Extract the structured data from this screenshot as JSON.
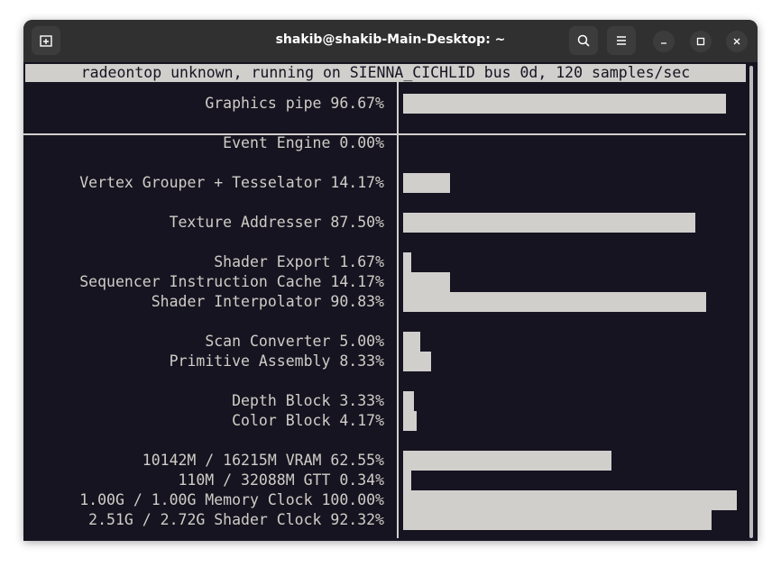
{
  "window": {
    "title": "shakib@shakib-Main-Desktop: ~",
    "icons": [
      "new-tab-icon",
      "search-icon",
      "menu-icon",
      "minimize-icon",
      "maximize-icon",
      "close-icon"
    ]
  },
  "terminal": {
    "header": "radeontop unknown, running on SIENNA_CICHLID bus 0d, 120 samples/sec",
    "rows": [
      {
        "label": "Graphics pipe",
        "value": "96.67%",
        "percent": 96.67
      },
      {
        "label": "Event Engine",
        "value": "0.00%",
        "percent": 0.0
      },
      {
        "label": "Vertex Grouper + Tesselator",
        "value": "14.17%",
        "percent": 14.17
      },
      {
        "label": "Texture Addresser",
        "value": "87.50%",
        "percent": 87.5
      },
      {
        "label": "Shader Export",
        "value": "1.67%",
        "percent": 1.67
      },
      {
        "label": "Sequencer Instruction Cache",
        "value": "14.17%",
        "percent": 14.17
      },
      {
        "label": "Shader Interpolator",
        "value": "90.83%",
        "percent": 90.83
      },
      {
        "label": "Scan Converter",
        "value": "5.00%",
        "percent": 5.0
      },
      {
        "label": "Primitive Assembly",
        "value": "8.33%",
        "percent": 8.33
      },
      {
        "label": "Depth Block",
        "value": "3.33%",
        "percent": 3.33
      },
      {
        "label": "Color Block",
        "value": "4.17%",
        "percent": 4.17
      },
      {
        "label": "10142M / 16215M VRAM",
        "value": "62.55%",
        "percent": 62.55
      },
      {
        "label": "110M / 32088M GTT",
        "value": "0.34%",
        "percent": 0.34
      },
      {
        "label": "1.00G / 1.00G Memory Clock",
        "value": "100.00%",
        "percent": 100.0
      },
      {
        "label": "2.51G / 2.72G Shader Clock",
        "value": "92.32%",
        "percent": 92.32
      }
    ]
  },
  "colors": {
    "terminal_bg": "#171421",
    "text": "#cfcdc7",
    "bar": "#d0cfcc",
    "titlebar": "#303030"
  }
}
